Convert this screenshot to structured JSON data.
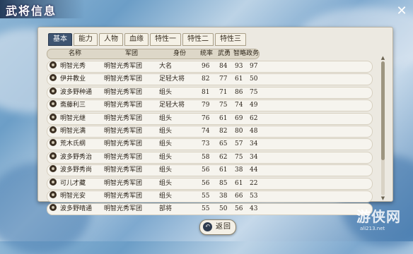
{
  "window": {
    "title": "武将信息",
    "close_glyph": "✕"
  },
  "tabs": [
    {
      "label": "基本",
      "active": true
    },
    {
      "label": "能力",
      "active": false
    },
    {
      "label": "人物",
      "active": false
    },
    {
      "label": "血缘",
      "active": false
    },
    {
      "label": "特性一",
      "active": false
    },
    {
      "label": "特性二",
      "active": false
    },
    {
      "label": "特性三",
      "active": false
    }
  ],
  "table": {
    "columns": [
      "名称",
      "军团",
      "身份",
      "统率",
      "武勇",
      "智略",
      "政务"
    ],
    "rows": [
      {
        "name": "明智光秀",
        "corps": "明智光秀军团",
        "rank": "大名",
        "leadership": "96",
        "valor": "84",
        "intellect": "93",
        "politics": "97"
      },
      {
        "name": "伊井教业",
        "corps": "明智光秀军团",
        "rank": "足轻大将",
        "leadership": "82",
        "valor": "77",
        "intellect": "61",
        "politics": "50"
      },
      {
        "name": "波多野种通",
        "corps": "明智光秀军团",
        "rank": "组头",
        "leadership": "81",
        "valor": "71",
        "intellect": "86",
        "politics": "75"
      },
      {
        "name": "斋藤利三",
        "corps": "明智光秀军团",
        "rank": "足轻大将",
        "leadership": "79",
        "valor": "75",
        "intellect": "74",
        "politics": "49"
      },
      {
        "name": "明智光继",
        "corps": "明智光秀军团",
        "rank": "组头",
        "leadership": "76",
        "valor": "61",
        "intellect": "69",
        "politics": "62"
      },
      {
        "name": "明智光满",
        "corps": "明智光秀军团",
        "rank": "组头",
        "leadership": "74",
        "valor": "82",
        "intellect": "80",
        "politics": "48"
      },
      {
        "name": "荒木氏纲",
        "corps": "明智光秀军团",
        "rank": "组头",
        "leadership": "73",
        "valor": "65",
        "intellect": "57",
        "politics": "34"
      },
      {
        "name": "波多野秀治",
        "corps": "明智光秀军团",
        "rank": "组头",
        "leadership": "58",
        "valor": "62",
        "intellect": "75",
        "politics": "34"
      },
      {
        "name": "波多野秀尚",
        "corps": "明智光秀军团",
        "rank": "组头",
        "leadership": "56",
        "valor": "61",
        "intellect": "38",
        "politics": "44"
      },
      {
        "name": "可儿才藏",
        "corps": "明智光秀军团",
        "rank": "组头",
        "leadership": "56",
        "valor": "85",
        "intellect": "61",
        "politics": "22"
      },
      {
        "name": "明智光安",
        "corps": "明智光秀军团",
        "rank": "组头",
        "leadership": "55",
        "valor": "38",
        "intellect": "66",
        "politics": "53"
      },
      {
        "name": "波多野晴通",
        "corps": "明智光秀军团",
        "rank": "部将",
        "leadership": "55",
        "valor": "50",
        "intellect": "56",
        "politics": "43"
      }
    ]
  },
  "scrollbar": {
    "position": 0.0
  },
  "footer": {
    "back_label": "返回",
    "back_icon": "↶"
  },
  "watermark": {
    "text": "游侠网",
    "sub": "ali213.net"
  }
}
